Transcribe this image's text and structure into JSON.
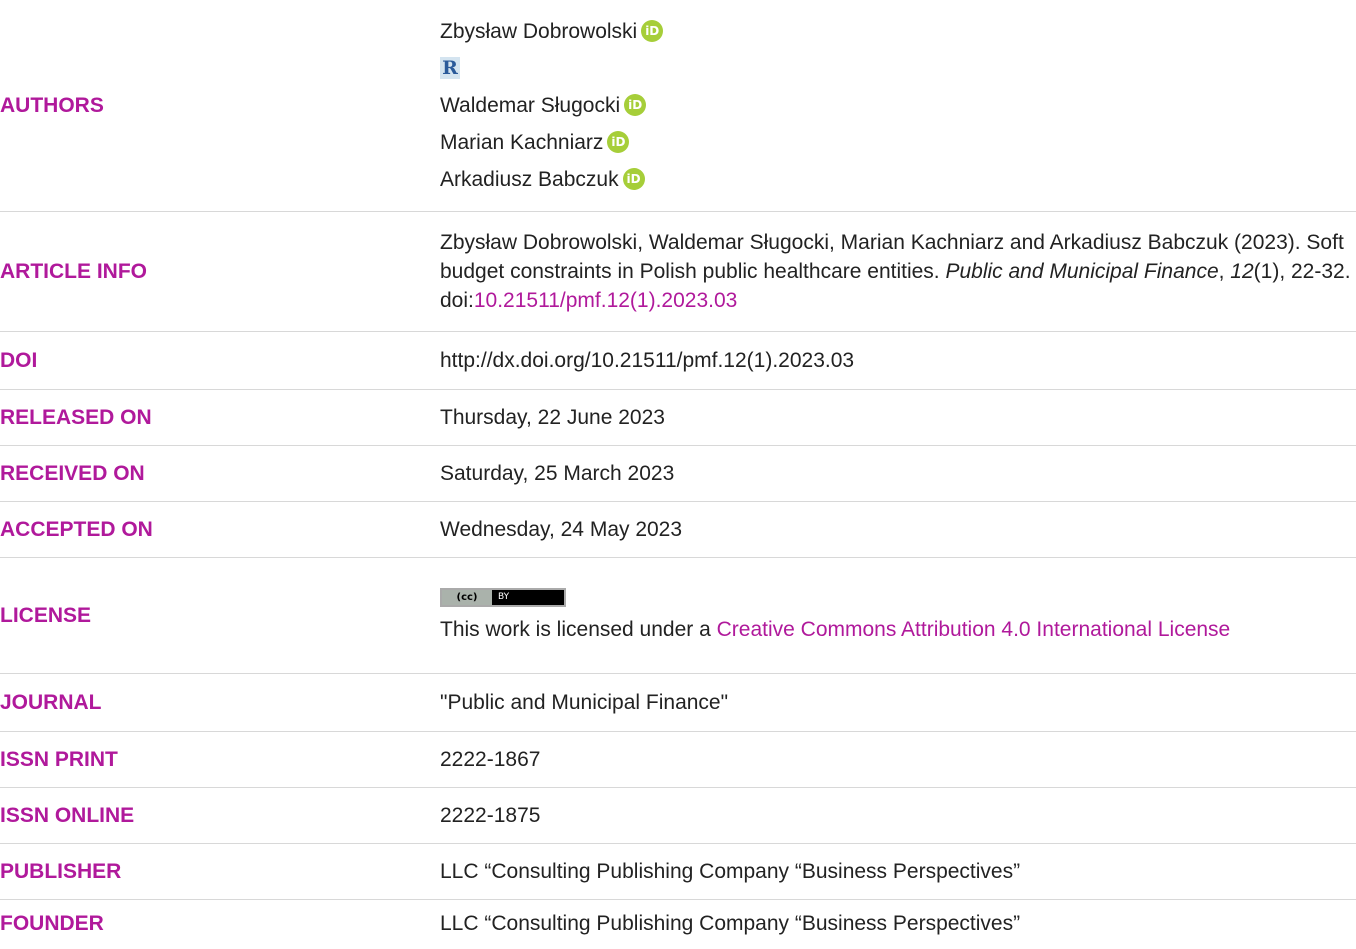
{
  "labels": {
    "authors": "AUTHORS",
    "article_info": "ARTICLE INFO",
    "doi": "DOI",
    "released_on": "RELEASED ON",
    "received_on": "RECEIVED ON",
    "accepted_on": "ACCEPTED ON",
    "license": "LICENSE",
    "journal": "JOURNAL",
    "issn_print": "ISSN PRINT",
    "issn_online": "ISSN ONLINE",
    "publisher": "PUBLISHER",
    "founder": "FOUNDER"
  },
  "authors": [
    {
      "name": "Zbysław Dobrowolski",
      "icon": "orcid-icon"
    },
    {
      "name": "Waldemar Sługocki",
      "icon": "orcid-icon"
    },
    {
      "name": "Marian Kachniarz",
      "icon": "orcid-icon"
    },
    {
      "name": "Arkadiusz Babczuk",
      "icon": "orcid-icon"
    }
  ],
  "researcherid_badge": "R",
  "orcid_glyph": "iD",
  "article_info": {
    "authors_year": "Zbysław Dobrowolski, Waldemar Sługocki, Marian Kachniarz and Arkadiusz Babczuk (2023). Soft budget constraints in Polish public healthcare entities. ",
    "journal_italic": "Public and Municipal Finance",
    "sep1": ", ",
    "volume_italic": "12",
    "issue_pages": "(1), 22-32. doi:",
    "doi_link": "10.21511/pmf.12(1).2023.03"
  },
  "doi": "http://dx.doi.org/10.21511/pmf.12(1).2023.03",
  "released_on": "Thursday, 22 June 2023",
  "received_on": "Saturday, 25 March 2023",
  "accepted_on": "Wednesday, 24 May 2023",
  "license": {
    "badge_cc": "cc",
    "badge_by": "BY",
    "text": "This work is licensed under a ",
    "link": "Creative Commons Attribution 4.0 International License"
  },
  "journal": "\"Public and Municipal Finance\"",
  "issn_print": "2222-1867",
  "issn_online": "2222-1875",
  "publisher": "LLC “Consulting Publishing Company “Business Perspectives”",
  "founder": "LLC “Consulting Publishing Company “Business Perspectives”",
  "colors": {
    "label": "#b0199b",
    "link": "#b0199b",
    "text": "#222222",
    "divider": "#d8d8d8",
    "orcid": "#a6ce39"
  }
}
